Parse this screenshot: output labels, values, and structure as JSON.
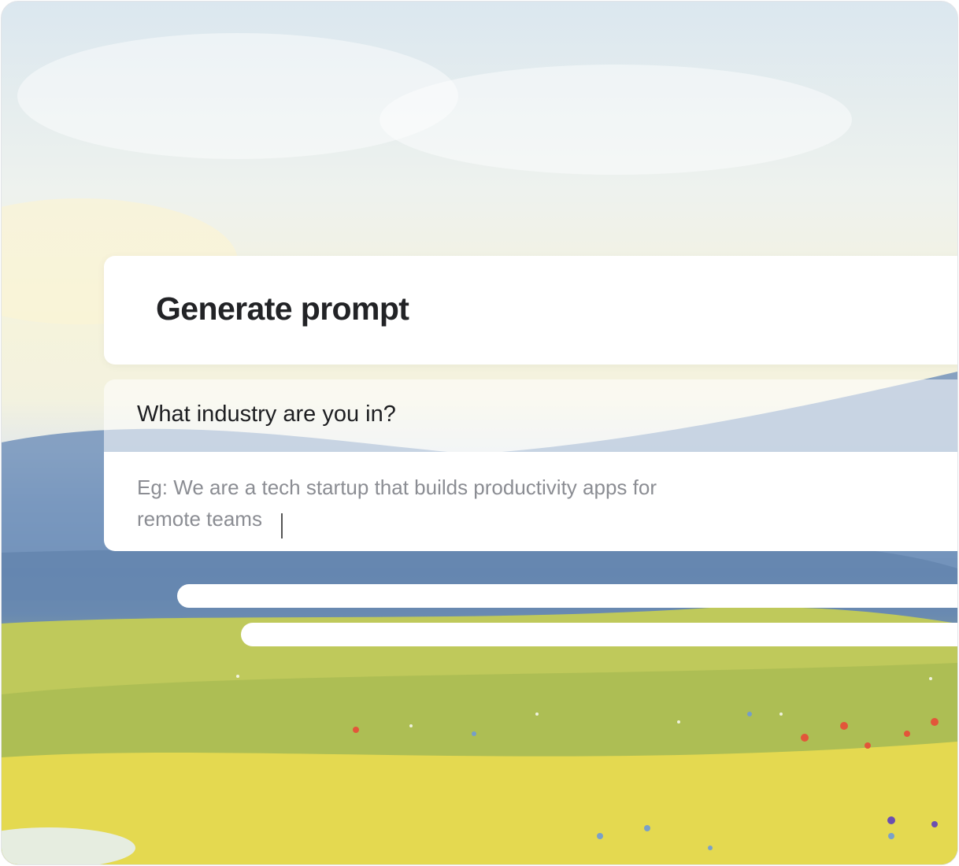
{
  "card": {
    "title": "Generate prompt",
    "question": "What industry are you in?",
    "input": {
      "placeholder_line1": "Eg: We are a tech startup that builds productivity apps for",
      "placeholder_line2": "remote teams"
    }
  },
  "background": {
    "description_icon": "landscape-illustration"
  }
}
